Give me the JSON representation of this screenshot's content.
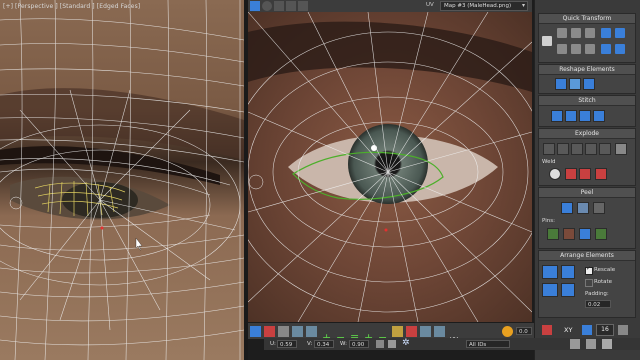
{
  "left_viewport": {
    "label": "[+] [Perspective ] [Standard ] [Edged Faces]"
  },
  "uv_toolbar": {
    "uv_label": "UV",
    "map_select": "Map #3 (MaleHead.png)"
  },
  "panel": {
    "quick_transform": "Quick Transform",
    "reshape_elements": "Reshape Elements",
    "stitch": "Stitch",
    "explode": "Explode",
    "weld": "Weld",
    "peel": "Peel",
    "pins": "Pins:",
    "arrange_elements": "Arrange Elements",
    "rescale": "Rescale",
    "rotate": "Rotate",
    "padding_label": "Padding:",
    "padding_value": "0.02",
    "rescale_checked": true,
    "rotate_checked": false
  },
  "bottom_toolbar": {
    "u_label": "U:",
    "u_value": "0.59",
    "v_label": "V:",
    "v_value": "0.34",
    "w_label": "W:",
    "w_value": "0.90",
    "offset_value": "0.0",
    "filter_select": "All IDs",
    "xy_label": "XY",
    "value_16": "16"
  },
  "colors": {
    "accent_blue": "#3a7fd9",
    "selection_green": "#4caf2a",
    "mesh_white": "#e8e8e8",
    "panel_bg": "#3a3a3a"
  }
}
